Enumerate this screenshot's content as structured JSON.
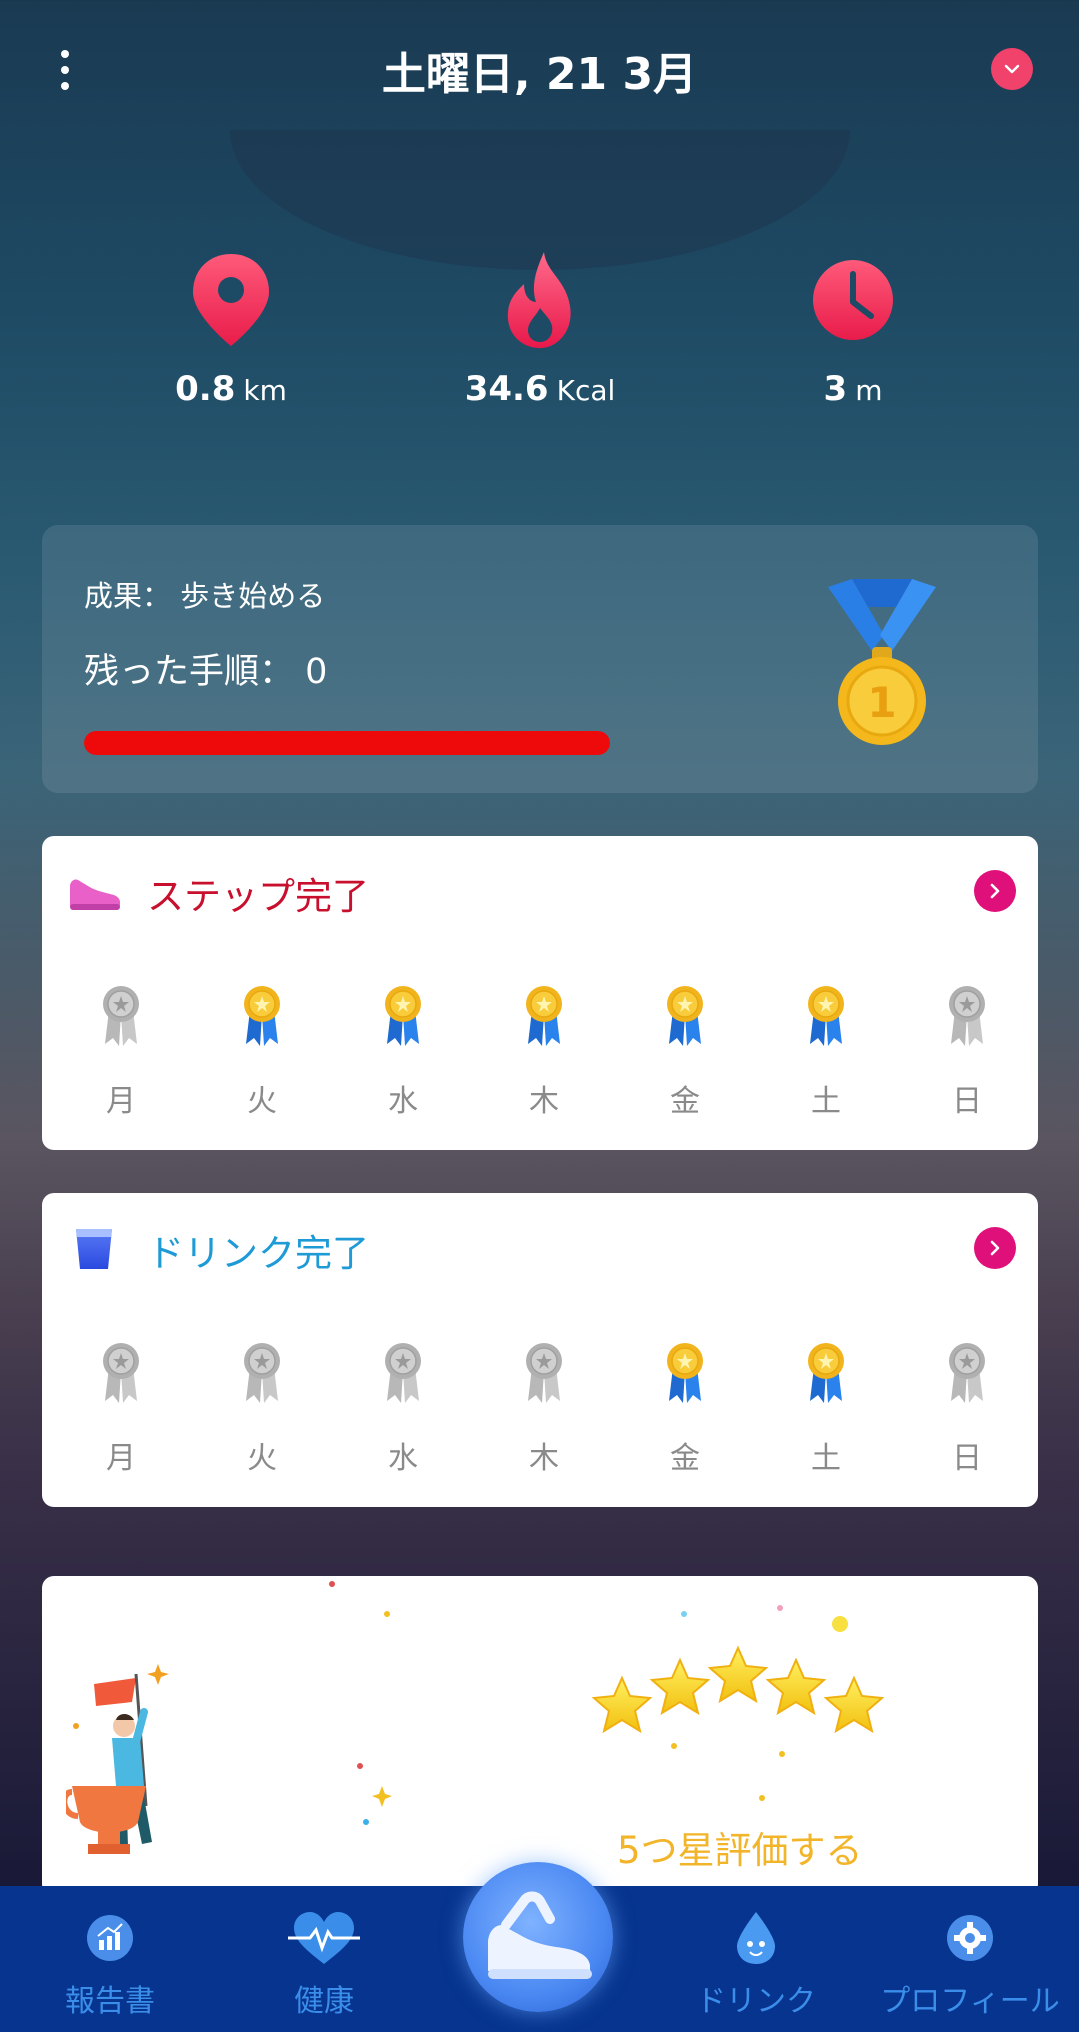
{
  "header": {
    "date": "土曜日, 21 3月"
  },
  "stats": [
    {
      "icon": "location-pin-icon",
      "value": "0.8",
      "unit": "km"
    },
    {
      "icon": "flame-icon",
      "value": "34.6",
      "unit": "Kcal"
    },
    {
      "icon": "clock-icon",
      "value": "3",
      "unit": "m"
    }
  ],
  "achievement": {
    "title": "成果： 歩き始める",
    "steps_left": "残った手順：  0",
    "progress": 1.0
  },
  "steps_card": {
    "title": "ステップ完了",
    "days": [
      {
        "label": "月",
        "done": false
      },
      {
        "label": "火",
        "done": true
      },
      {
        "label": "水",
        "done": true
      },
      {
        "label": "木",
        "done": true
      },
      {
        "label": "金",
        "done": true
      },
      {
        "label": "土",
        "done": true
      },
      {
        "label": "日",
        "done": false
      }
    ]
  },
  "drink_card": {
    "title": "ドリンク完了",
    "days": [
      {
        "label": "月",
        "done": false
      },
      {
        "label": "火",
        "done": false
      },
      {
        "label": "水",
        "done": false
      },
      {
        "label": "木",
        "done": false
      },
      {
        "label": "金",
        "done": true
      },
      {
        "label": "土",
        "done": true
      },
      {
        "label": "日",
        "done": false
      }
    ]
  },
  "rate": {
    "text": "5つ星評価する"
  },
  "nav": {
    "report": "報告書",
    "health": "健康",
    "drink": "ドリンク",
    "profile": "プロフィール"
  },
  "colors": {
    "accent": "#f0426a",
    "progress": "#ee0a0a",
    "steps_title": "#c8102e",
    "drink_title": "#1e9ad6",
    "rate_text": "#f2b428",
    "nav_bg": "#06348f",
    "nav_label": "#3a8eea"
  }
}
